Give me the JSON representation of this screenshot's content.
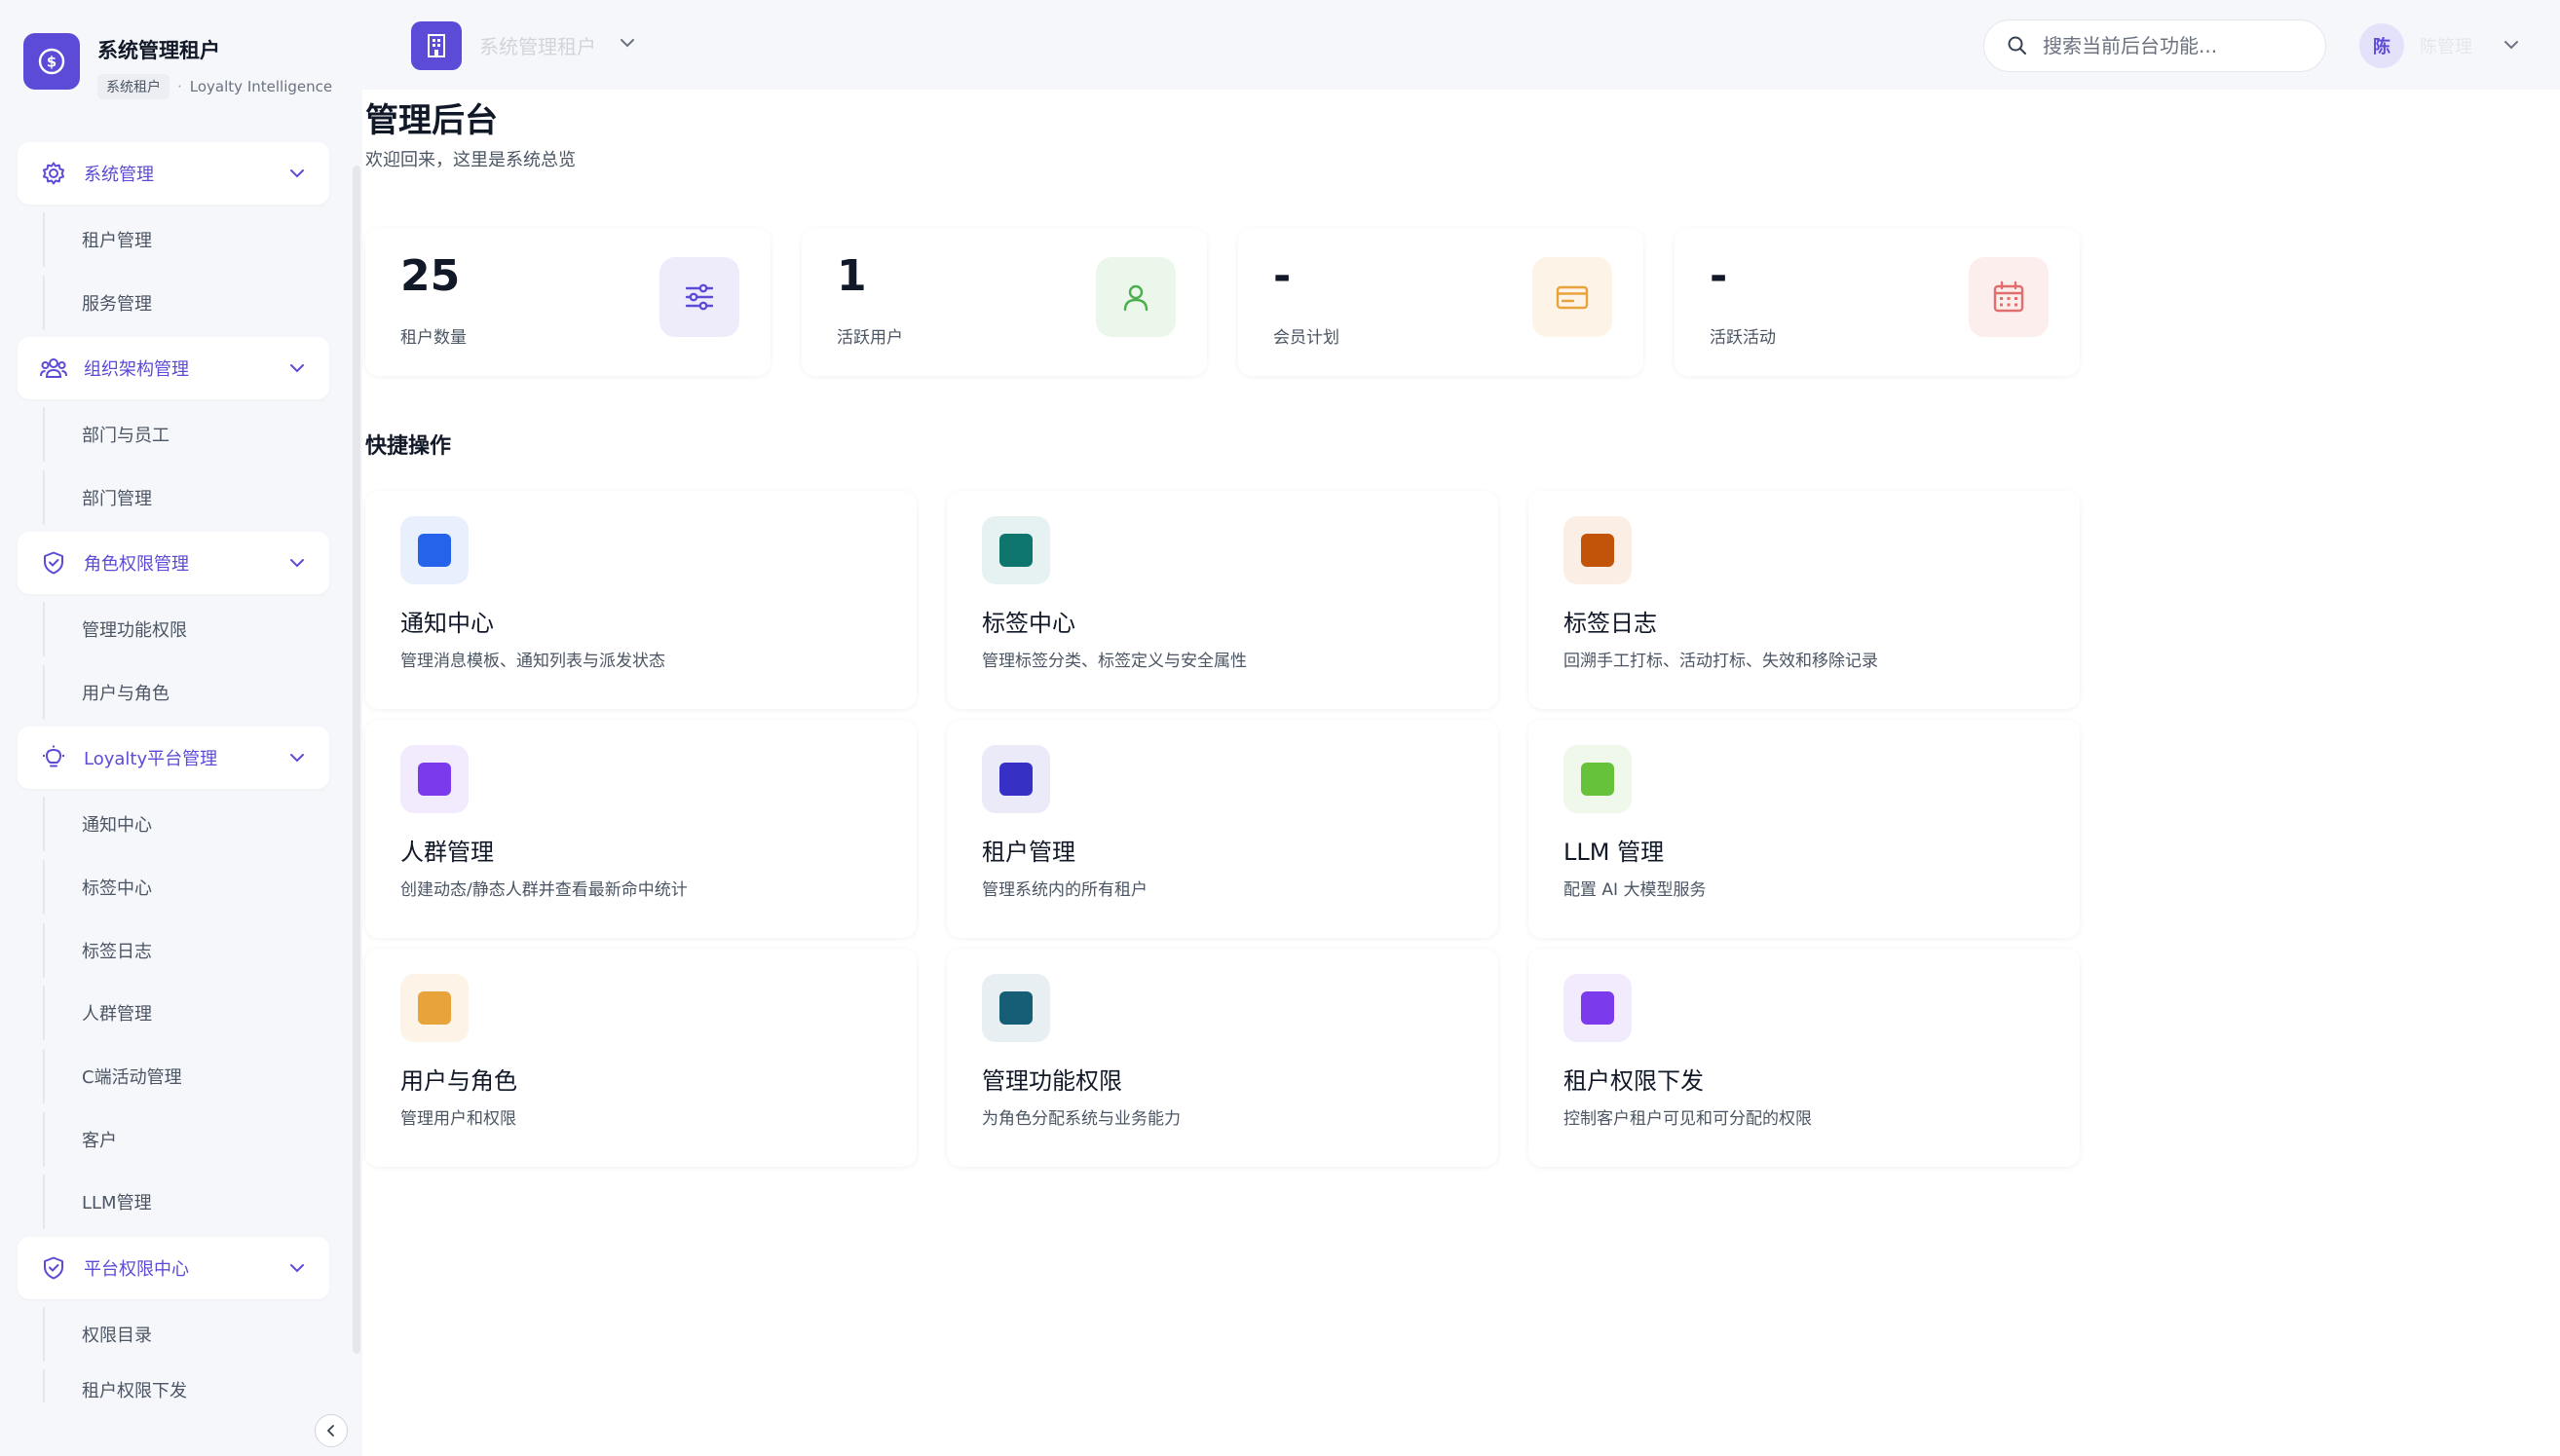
{
  "brand": {
    "title": "系统管理租户",
    "tag": "系统租户",
    "separator": "·",
    "product": "Loyalty Intelligence"
  },
  "sidebar": {
    "groups": [
      {
        "label": "系统管理",
        "icon": "gear-icon",
        "items": [
          "租户管理",
          "服务管理"
        ]
      },
      {
        "label": "组织架构管理",
        "icon": "users-icon",
        "items": [
          "部门与员工",
          "部门管理"
        ]
      },
      {
        "label": "角色权限管理",
        "icon": "shield-check-icon",
        "items": [
          "管理功能权限",
          "用户与角色"
        ]
      },
      {
        "label": "Loyalty平台管理",
        "icon": "lightbulb-icon",
        "items": [
          "通知中心",
          "标签中心",
          "标签日志",
          "人群管理",
          "C端活动管理",
          "客户",
          "LLM管理"
        ]
      },
      {
        "label": "平台权限中心",
        "icon": "shield-check-icon",
        "items": [
          "权限目录",
          "租户权限下发"
        ]
      }
    ]
  },
  "topbar": {
    "tenant_name": "系统管理租户",
    "search_placeholder": "搜索当前后台功能...",
    "avatar_initial": "陈",
    "user_name": "陈管理"
  },
  "page": {
    "title": "管理后台",
    "subtitle": "欢迎回来，这里是系统总览"
  },
  "stats": [
    {
      "value": "25",
      "label": "租户数量",
      "icon": "sliders-icon",
      "color": "#5b4bd6",
      "bg": "#eeecfb"
    },
    {
      "value": "1",
      "label": "活跃用户",
      "icon": "user-icon",
      "color": "#4cae4c",
      "bg": "#ecf7ec"
    },
    {
      "value": "-",
      "label": "会员计划",
      "icon": "credit-card-icon",
      "color": "#e8a33a",
      "bg": "#fdf3e6"
    },
    {
      "value": "-",
      "label": "活跃活动",
      "icon": "calendar-icon",
      "color": "#e26d6d",
      "bg": "#fdeeee"
    }
  ],
  "quick_actions_title": "快捷操作",
  "actions": [
    {
      "title": "通知中心",
      "desc": "管理消息模板、通知列表与派发状态",
      "color": "#2563eb",
      "bg": "#e8f0fd"
    },
    {
      "title": "标签中心",
      "desc": "管理标签分类、标签定义与安全属性",
      "color": "#0f766e",
      "bg": "#e6f2f1"
    },
    {
      "title": "标签日志",
      "desc": "回溯手工打标、活动打标、失效和移除记录",
      "color": "#c2540a",
      "bg": "#fbeee5"
    },
    {
      "title": "人群管理",
      "desc": "创建动态/静态人群并查看最新命中统计",
      "color": "#7c3aed",
      "bg": "#f1ebfd"
    },
    {
      "title": "租户管理",
      "desc": "管理系统内的所有租户",
      "color": "#3730c4",
      "bg": "#ebeaf9"
    },
    {
      "title": "LLM 管理",
      "desc": "配置 AI 大模型服务",
      "color": "#65c23a",
      "bg": "#eff8ea"
    },
    {
      "title": "用户与角色",
      "desc": "管理用户和权限",
      "color": "#e8a33a",
      "bg": "#fdf3e6"
    },
    {
      "title": "管理功能权限",
      "desc": "为角色分配系统与业务能力",
      "color": "#155e75",
      "bg": "#e7eff2"
    },
    {
      "title": "租户权限下发",
      "desc": "控制客户租户可见和可分配的权限",
      "color": "#7c3aed",
      "bg": "#f1ebfd"
    }
  ]
}
